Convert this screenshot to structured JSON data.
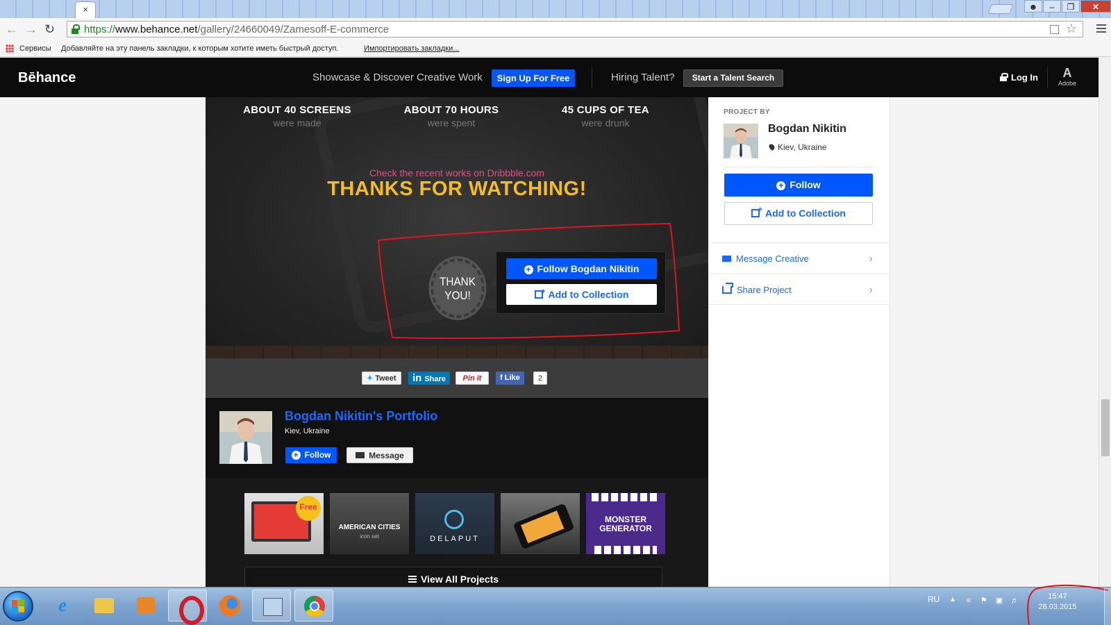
{
  "browser": {
    "tab_close": "×",
    "url_scheme": "https://",
    "url_host": "www.behance.net",
    "url_path": "/gallery/24660049/Zamesoff-E-commerce",
    "bookmarks_apps": "Сервисы",
    "bookmarks_hint": "Добавляйте на эту панель закладки, к которым хотите иметь быстрый доступ.",
    "bookmarks_import": "Импортировать закладки..."
  },
  "header": {
    "logo": "Bēhance",
    "tagline": "Showcase & Discover Creative Work",
    "signup": "Sign Up For Free",
    "hiring": "Hiring Talent?",
    "talent_search": "Start a Talent Search",
    "login": "Log In",
    "adobe": "Adobe"
  },
  "project": {
    "stats": [
      {
        "big": "ABOUT 40 SCREENS",
        "small": "were made"
      },
      {
        "big": "ABOUT 70 HOURS",
        "small": "were spent"
      },
      {
        "big": "45 CUPS OF TEA",
        "small": "were drunk"
      }
    ],
    "dribbble": "Check the recent works on Dribbble.com",
    "thanks": "THANKS FOR WATCHING!",
    "badge_line1": "THANK",
    "badge_line2": "YOU!",
    "cta_follow": "Follow Bogdan Nikitin",
    "cta_collect": "Add to Collection",
    "share": {
      "tweet": "Tweet",
      "linkedin": "Share",
      "pinterest": "Pin it",
      "facebook": "Like",
      "fb_count": "2"
    },
    "portfolio": {
      "name": "Bogdan Nikitin's Portfolio",
      "location": "Kiev, Ukraine",
      "follow": "Follow",
      "message": "Message"
    },
    "thumbs": {
      "t1_badge": "Free",
      "t2_title": "AMERICAN CITIES",
      "t2_sub": "icon set",
      "t3_title": "DELAPUT",
      "t5_title_1": "MONSTER",
      "t5_title_2": "GENERATOR"
    },
    "view_all": "View All Projects"
  },
  "sidebar": {
    "label": "PROJECT BY",
    "name": "Bogdan Nikitin",
    "location": "Kiev, Ukraine",
    "follow": "Follow",
    "add_collection": "Add to Collection",
    "message": "Message Creative",
    "share": "Share Project"
  },
  "taskbar": {
    "lang": "RU",
    "time": "15:47",
    "date": "28.03.2015"
  },
  "colors": {
    "behance_blue": "#0057ff",
    "thanks_yellow": "#f5bd1f",
    "dribbble_pink": "#e84b8a",
    "annotation_red": "#e0141e"
  }
}
